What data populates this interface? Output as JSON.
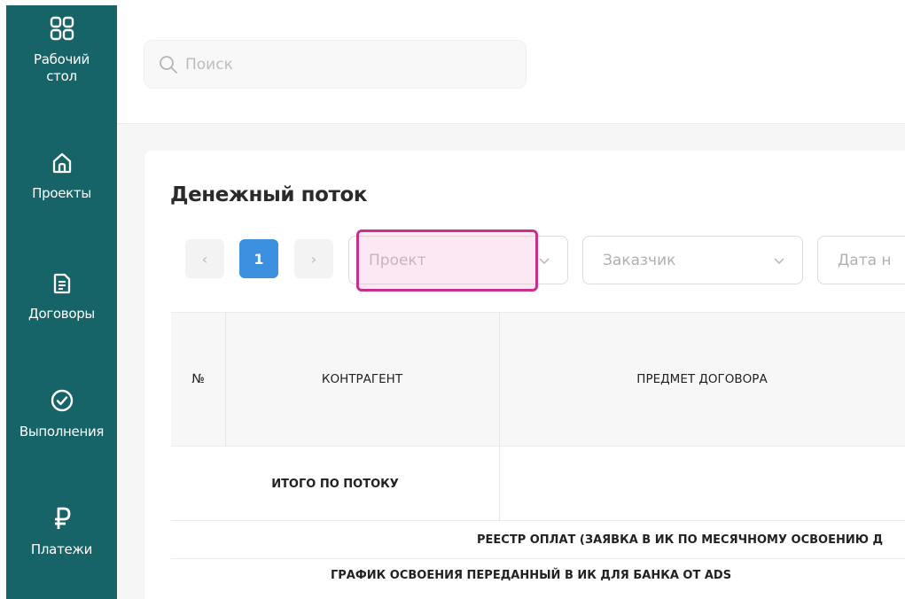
{
  "sidebar": {
    "items": [
      {
        "label": "Рабочий\nстол",
        "icon": "grid-icon"
      },
      {
        "label": "Проекты",
        "icon": "home-icon"
      },
      {
        "label": "Договоры",
        "icon": "document-icon"
      },
      {
        "label": "Выполнения",
        "icon": "check-circle-icon"
      },
      {
        "label": "Платежи",
        "icon": "ruble-icon"
      }
    ]
  },
  "search": {
    "placeholder": "Поиск"
  },
  "page": {
    "title": "Денежный поток"
  },
  "pagination": {
    "prev": "‹",
    "current": "1",
    "next": "›"
  },
  "filters": {
    "project_placeholder": "Проект",
    "customer_placeholder": "Заказчик",
    "date_placeholder": "Дата н"
  },
  "table": {
    "headers": [
      "№",
      "КОНТРАГЕНТ",
      "ПРЕДМЕТ ДОГОВОРА"
    ],
    "total_label": "ИТОГО ПО ПОТОКУ",
    "registry_label": "РЕЕСТР ОПЛАТ (ЗАЯВКА В ИК ПО МЕСЯЧНОМУ ОСВОЕНИЮ Д",
    "schedule_label": "ГРАФИК ОСВОЕНИЯ ПЕРЕДАННЫЙ В ИК ДЛЯ БАНКА ОТ ADS"
  },
  "colors": {
    "sidebar_bg": "#166468",
    "accent_blue": "#3d8fe0",
    "highlight": "#c8308c"
  }
}
